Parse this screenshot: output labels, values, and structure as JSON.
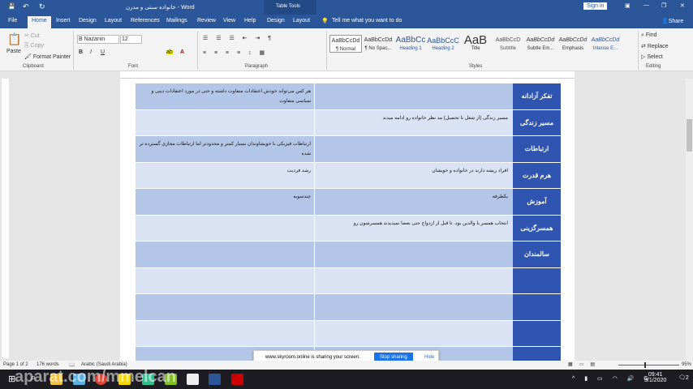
{
  "title": {
    "doc": "خانواده سنتی و مدرن",
    "sep": " - ",
    "app": "Word",
    "contextual": "Table Tools",
    "sign_in": "Sign in"
  },
  "tabs": [
    "File",
    "Home",
    "Insert",
    "Design",
    "Layout",
    "References",
    "Mailings",
    "Review",
    "View",
    "Help",
    "Design",
    "Layout"
  ],
  "tell_me": "Tell me what you want to do",
  "share": "Share",
  "clipboard": {
    "paste": "Paste",
    "cut": "Cut",
    "copy": "Copy",
    "format_painter": "Format Painter",
    "label": "Clipboard"
  },
  "font": {
    "name": "B Nazanin",
    "size": "12",
    "label": "Font"
  },
  "paragraph": {
    "label": "Paragraph"
  },
  "styles": {
    "items": [
      {
        "preview": "AaBbCcDd",
        "name": "¶ Normal"
      },
      {
        "preview": "AaBbCcDd",
        "name": "¶ No Spac..."
      },
      {
        "preview": "AaBbCc",
        "name": "Heading 1"
      },
      {
        "preview": "AaBbCcC",
        "name": "Heading 2"
      },
      {
        "preview": "AaB",
        "name": "Title"
      },
      {
        "preview": "AaBbCcD",
        "name": "Subtitle"
      },
      {
        "preview": "AaBbCcDd",
        "name": "Subtle Em..."
      },
      {
        "preview": "AaBbCcDd",
        "name": "Emphasis"
      },
      {
        "preview": "AaBbCcDd",
        "name": "Intense E..."
      }
    ],
    "label": "Styles"
  },
  "editing": {
    "find": "Find",
    "replace": "Replace",
    "select": "Select",
    "label": "Editing"
  },
  "table": {
    "rows": [
      {
        "header": "تفکر آزادانه",
        "middle": "",
        "left": "هر کس می‌تواند خودش اعتقادات متفاوت داشته و حتی در مورد اعتقادات دینی و سیاسی متفاوت"
      },
      {
        "header": "مسیر زندگی",
        "middle": "مسیر زندگی (از شغل تا تحصیل) مد نظر خانواده رو ادامه میدند",
        "left": ""
      },
      {
        "header": "ارتباطات",
        "middle": "",
        "left": "ارتباطات فیزیکی با خویشاوندان بسیار کمتر و محدودتر اما ارتباطات مجازی گسترده تر شده"
      },
      {
        "header": "هرم قدرت",
        "middle": "افراد ریشه دارند در خانواده و خویشان",
        "left": "رشد فردیت"
      },
      {
        "header": "آموزش",
        "middle": "یکطرفه",
        "left": "چندسویه"
      },
      {
        "header": "همسرگزینی",
        "middle": "انتخاب همسر با والدین بود. تا قبل از ازدواج حتی بعضا نمیدیدند همسرشون رو",
        "left": ""
      },
      {
        "header": "سالمندان",
        "middle": "",
        "left": ""
      },
      {
        "header": "",
        "middle": "",
        "left": ""
      },
      {
        "header": "",
        "middle": "",
        "left": ""
      },
      {
        "header": "",
        "middle": "",
        "left": ""
      },
      {
        "header": "",
        "middle": "",
        "left": ""
      }
    ]
  },
  "sharing": {
    "text": "www.skyroom.online is sharing your screen.",
    "stop": "Stop sharing",
    "hide": "Hide"
  },
  "status": {
    "page": "Page 1 of 2",
    "words": "176 words",
    "language": "Arabic (Saudi Arabia)",
    "zoom": "95%"
  },
  "clock": {
    "time": "09:41",
    "date": "3/1/2020",
    "notifications": "2"
  },
  "watermark": "aparat.com/mmelcan"
}
